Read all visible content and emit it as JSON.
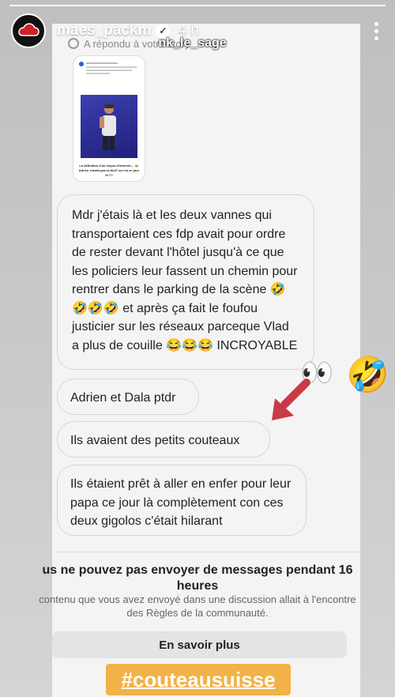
{
  "header": {
    "username": "maes_packm",
    "verified_icon": "verified-badge-icon",
    "time": "4 h",
    "more_icon": "more-vertical-icon",
    "progress": 1.0
  },
  "reply": {
    "prefix": "A répondu à votre story",
    "sticker": "nk_le_sage"
  },
  "story_card": {
    "caption": "La définition d'un voyou d'internet… 😹 Adrien n'avait pas la Ak47 sur lui ce jour là ??"
  },
  "messages": [
    {
      "text": "Mdr j'étais là et les deux vannes qui transportaient ces fdp avait pour ordre de rester devant l'hôtel jusqu'à ce que les policiers leur fassent un chemin pour rentrer dans le parking de la scène 🤣🤣🤣🤣 et après ça fait le foufou justicier sur les réseaux parceque Vlad a plus de couille 😂😂😂 INCROYABLE"
    },
    {
      "text": "Adrien et Dala ptdr"
    },
    {
      "text": "Ils avaient des petits couteaux"
    },
    {
      "text": "Ils étaient prêt à aller en enfer pour leur papa ce jour là complètement con ces deux gigolos c'était hilarant"
    }
  ],
  "stickers": {
    "eyes": "👀",
    "laugh": "🤣"
  },
  "restriction": {
    "title": "us ne pouvez pas envoyer de messages pendant 16 heures",
    "body": "contenu que vous avez envoyé dans une discussion allait à l'encontre des Règles de la communauté.",
    "button": "En savoir plus"
  },
  "hashtag": "#couteausuisse",
  "colors": {
    "hashtag_bg": "#f1b248",
    "arrow": "#d0404a",
    "bubble_border": "#d6d6d6"
  }
}
